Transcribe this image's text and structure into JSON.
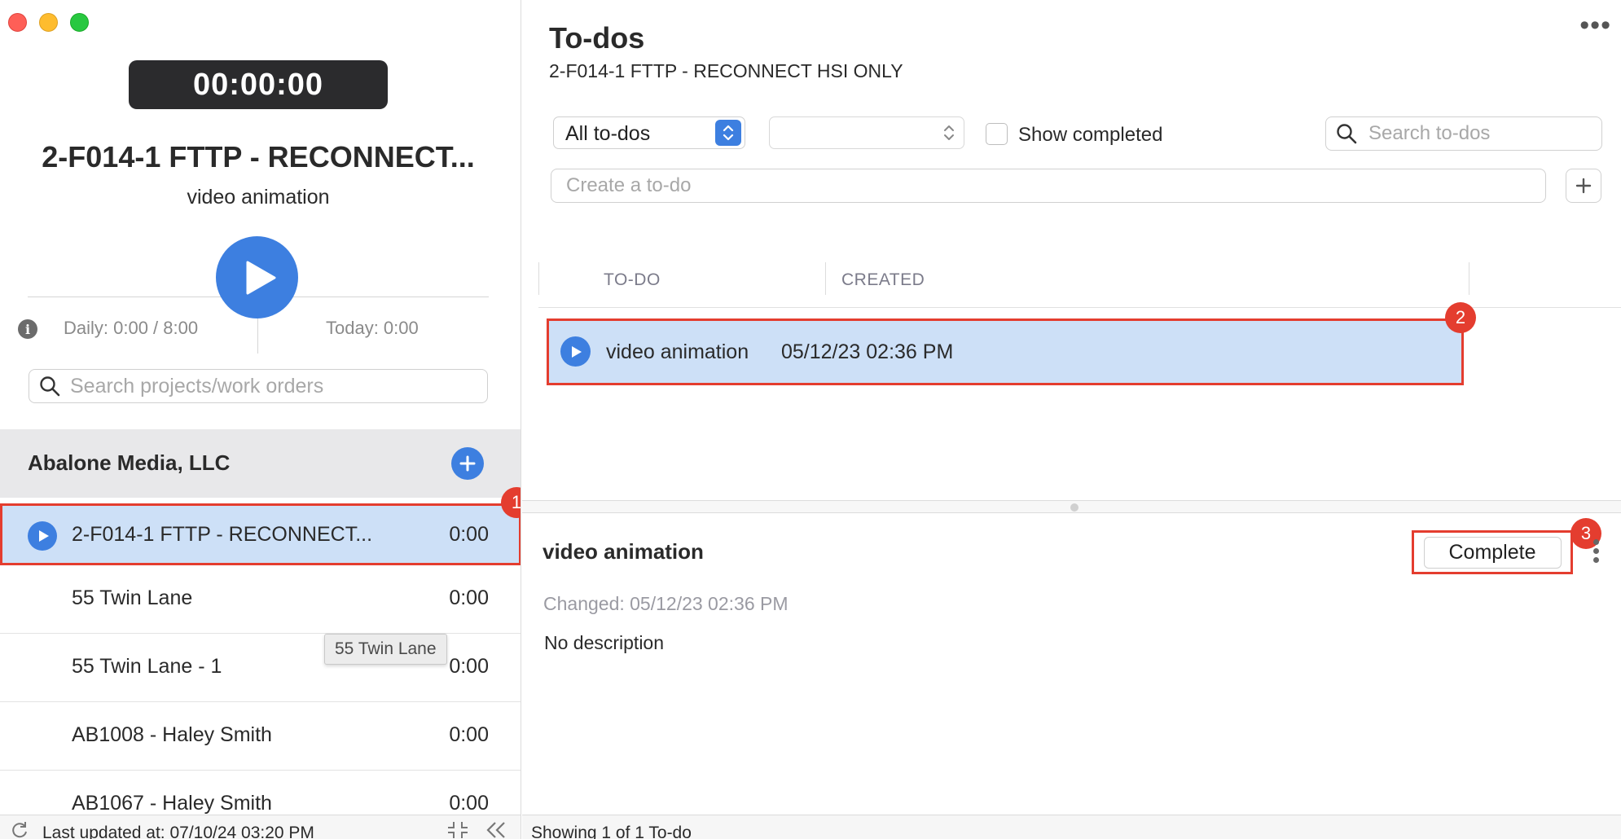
{
  "timer": "00:00:00",
  "project": {
    "title": "2-F014-1 FTTP - RECONNECT...",
    "subtitle": "video animation",
    "daily": "Daily: 0:00 / 8:00",
    "today": "Today: 0:00"
  },
  "left_search": {
    "placeholder": "Search projects/work orders"
  },
  "client": {
    "name": "Abalone Media, LLC"
  },
  "projects": [
    {
      "name": "2-F014-1 FTTP - RECONNECT...",
      "time": "0:00"
    },
    {
      "name": "55 Twin Lane",
      "time": "0:00"
    },
    {
      "name": "55 Twin Lane - 1",
      "time": "0:00"
    },
    {
      "name": "AB1008 - Haley Smith",
      "time": "0:00"
    },
    {
      "name": "AB1067 - Haley Smith",
      "time": "0:00"
    }
  ],
  "tooltip": "55 Twin Lane",
  "left_footer": {
    "last_updated": "Last updated at: 07/10/24 03:20 PM"
  },
  "todos_page": {
    "title": "To-dos",
    "subtitle": "2-F014-1 FTTP - RECONNECT HSI ONLY",
    "filter_selected": "All to-dos",
    "secondary_selected": "",
    "show_completed_label": "Show completed",
    "search_placeholder": "Search to-dos",
    "create_placeholder": "Create a to-do",
    "columns": {
      "todo": "TO-DO",
      "created": "CREATED"
    },
    "rows": [
      {
        "name": "video animation",
        "created": "05/12/23 02:36 PM"
      }
    ]
  },
  "detail": {
    "title": "video animation",
    "complete_label": "Complete",
    "changed": "Changed: 05/12/23 02:36 PM",
    "description": "No description"
  },
  "right_footer": {
    "showing": "Showing 1 of 1 To-do"
  },
  "badges": {
    "b1": "1",
    "b2": "2",
    "b3": "3"
  },
  "colors": {
    "accent": "#3d7fe0",
    "selection": "#cde0f7",
    "highlight": "#e43d2f",
    "timer_bg": "#2b2b2d"
  }
}
